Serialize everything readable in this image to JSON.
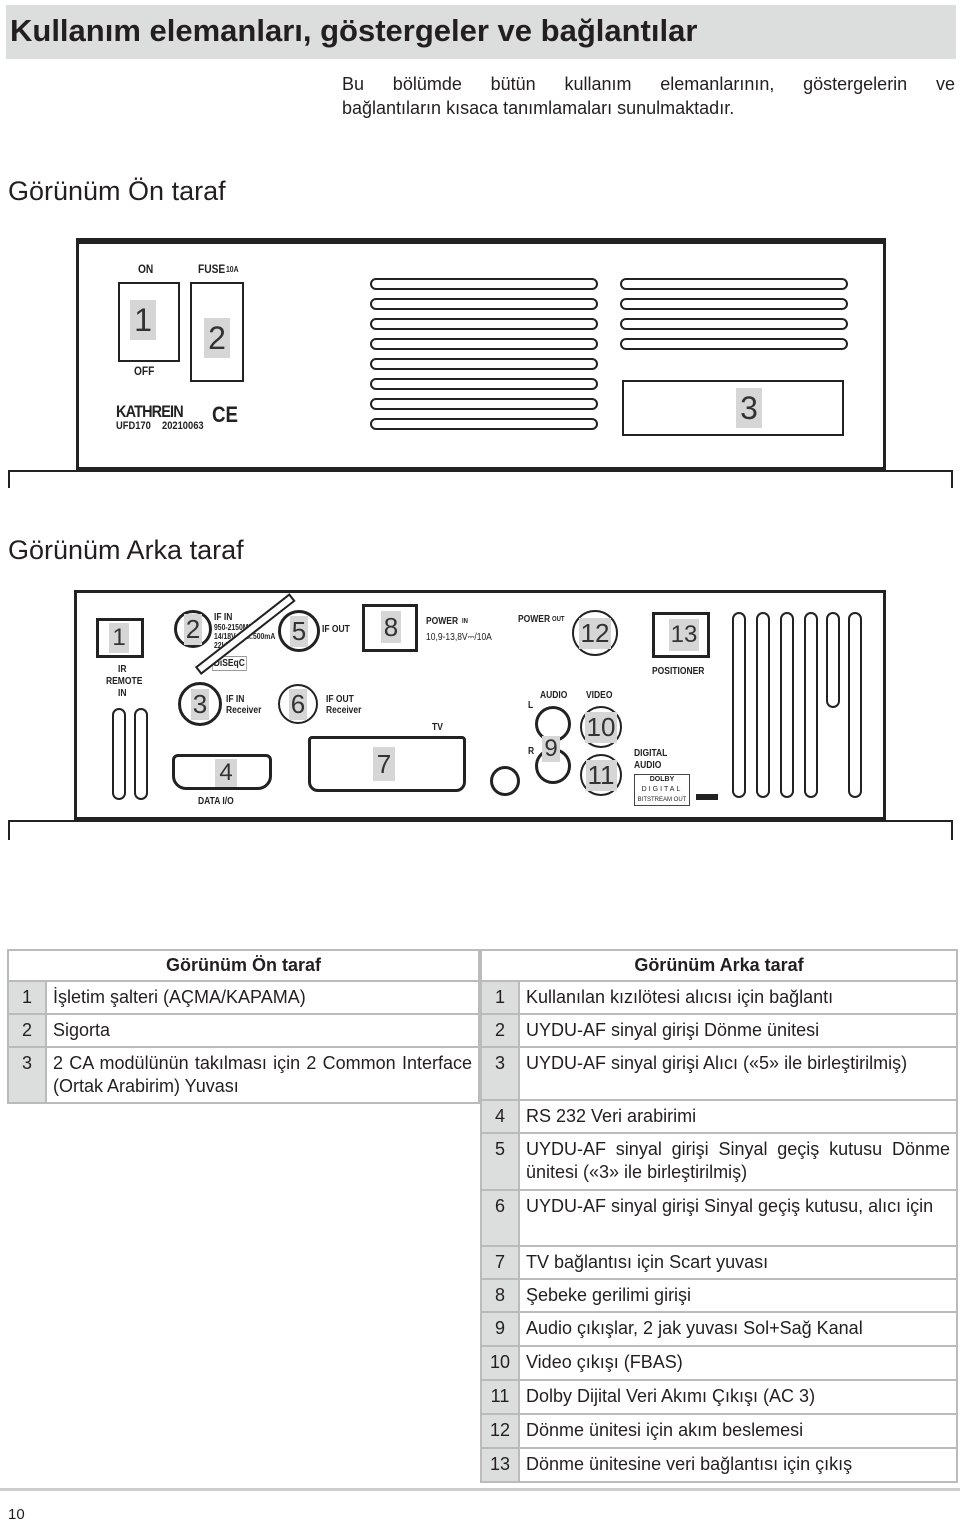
{
  "title": "Kullanım elemanları, göstergeler ve bağlantılar",
  "intro": {
    "line1": "Bu bölümde bütün kullanım elemanlarının, göstergelerin ve",
    "line2": "bağlantıların kısaca tanımlamaları sunulmaktadır."
  },
  "front_heading": "Görünüm Ön taraf",
  "back_heading": "Görünüm Arka taraf",
  "front_panel": {
    "on": "ON",
    "fuse": "FUSE",
    "fuse_rating": "10A",
    "off": "OFF",
    "brand": "KATHREIN",
    "model": "UFD170",
    "serial": "20210063",
    "ce": "CE",
    "callouts": [
      "1",
      "2",
      "3"
    ]
  },
  "back_panel": {
    "ir": "IR",
    "remote": "REMOTE",
    "in": "IN",
    "if_in": "IF IN",
    "if_in_spec1": "950-2150MHz",
    "if_in_spec2": "14/18V max.500mA",
    "if_in_spec3": "22kHz",
    "diseqc": "DiSEqC",
    "if_out": "IF OUT",
    "if_in_receiver": "IF IN",
    "receiver": "Receiver",
    "if_out_receiver": "IF OUT",
    "receiver2": "Receiver",
    "power_in": "POWER",
    "power_in_sub": "IN",
    "power_spec": "10,9-13,8V⎓/10A",
    "tv": "TV",
    "data_io": "DATA I/O",
    "power_out": "POWER",
    "power_out_sub": "OUT",
    "positioner": "POSITIONER",
    "audio": "AUDIO",
    "video": "VIDEO",
    "l": "L",
    "r": "R",
    "digital_audio1": "DIGITAL",
    "digital_audio2": "AUDIO",
    "dolby": "DOLBY",
    "digital": "DIGITAL",
    "bitstream": "BITSTREAM OUT",
    "callouts": [
      "1",
      "2",
      "3",
      "4",
      "5",
      "6",
      "7",
      "8",
      "9",
      "10",
      "11",
      "12",
      "13"
    ]
  },
  "table_front": {
    "header": "Görünüm Ön taraf",
    "rows": [
      {
        "n": "1",
        "t": "İşletim şalteri (AÇMA/KAPAMA)"
      },
      {
        "n": "2",
        "t": "Sigorta"
      },
      {
        "n": "3",
        "t": "2 CA modülünün takılması için 2 Common Interface (Ortak Arabirim) Yuvası"
      }
    ]
  },
  "table_back": {
    "header": "Görünüm Arka taraf",
    "rows": [
      {
        "n": "1",
        "t": "Kullanılan kızılötesi alıcısı için bağlantı"
      },
      {
        "n": "2",
        "t": "UYDU-AF sinyal girişi Dönme ünitesi"
      },
      {
        "n": "3",
        "t": "UYDU-AF sinyal girişi Alıcı («5» ile birleştirilmiş)"
      },
      {
        "n": "4",
        "t": "RS 232 Veri arabirimi"
      },
      {
        "n": "5",
        "t": "UYDU-AF sinyal girişi Sinyal geçiş kutusu Dönme ünitesi («3» ile birleştirilmiş)"
      },
      {
        "n": "6",
        "t": "UYDU-AF sinyal girişi Sinyal geçiş kutusu, alıcı için"
      },
      {
        "n": "7",
        "t": "TV bağlantısı için Scart yuvası"
      },
      {
        "n": "8",
        "t": "Şebeke gerilimi girişi"
      },
      {
        "n": "9",
        "t": "Audio çıkışlar, 2 jak yuvası Sol+Sağ Kanal"
      },
      {
        "n": "10",
        "t": "Video çıkışı (FBAS)"
      },
      {
        "n": "11",
        "t": "Dolby Dijital Veri Akımı Çıkışı (AC 3)"
      },
      {
        "n": "12",
        "t": "Dönme ünitesi için akım beslemesi"
      },
      {
        "n": "13",
        "t": "Dönme ünitesine veri bağlantısı için çıkış"
      }
    ]
  },
  "page_number": "10"
}
